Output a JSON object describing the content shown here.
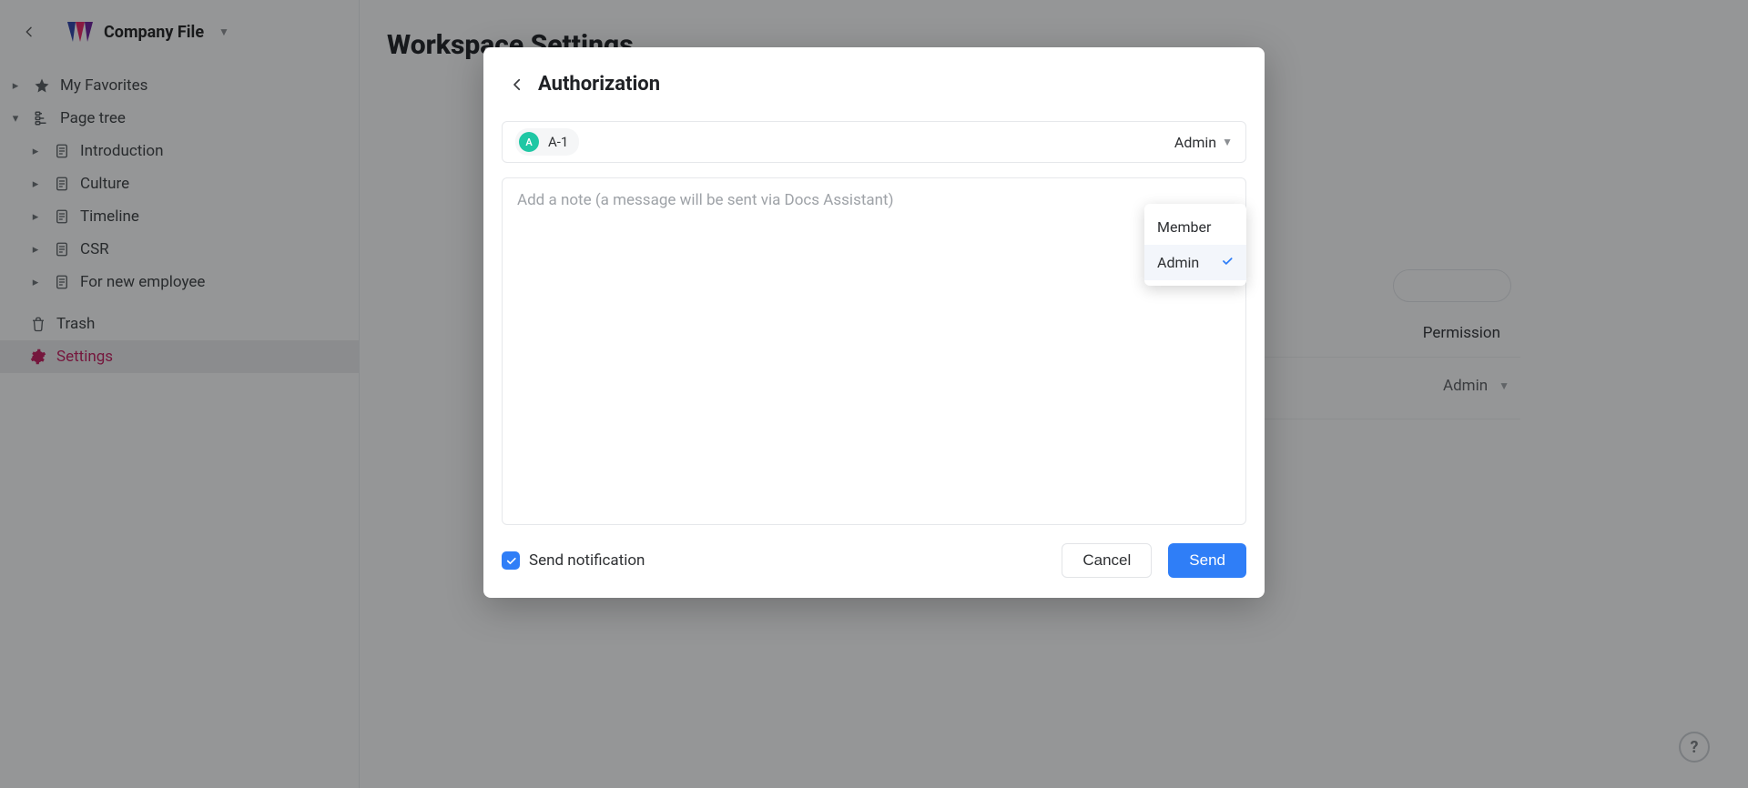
{
  "workspace": {
    "name": "Company File"
  },
  "sidebar": {
    "favorites_label": "My Favorites",
    "page_tree_label": "Page tree",
    "pages": [
      {
        "label": "Introduction"
      },
      {
        "label": "Culture"
      },
      {
        "label": "Timeline"
      },
      {
        "label": "CSR"
      },
      {
        "label": "For new employee"
      }
    ],
    "trash_label": "Trash",
    "settings_label": "Settings"
  },
  "main": {
    "title": "Workspace Settings",
    "permission_header": "Permission",
    "permission_value": "Admin"
  },
  "modal": {
    "title": "Authorization",
    "recipient": {
      "avatar_initial": "A",
      "label": "A-1"
    },
    "role_selected": "Admin",
    "role_options": [
      {
        "label": "Member",
        "selected": false
      },
      {
        "label": "Admin",
        "selected": true
      }
    ],
    "note_placeholder": "Add a note (a message will be sent via Docs Assistant)",
    "send_notification_label": "Send notification",
    "send_notification_checked": true,
    "cancel_label": "Cancel",
    "send_label": "Send"
  },
  "help_label": "?"
}
